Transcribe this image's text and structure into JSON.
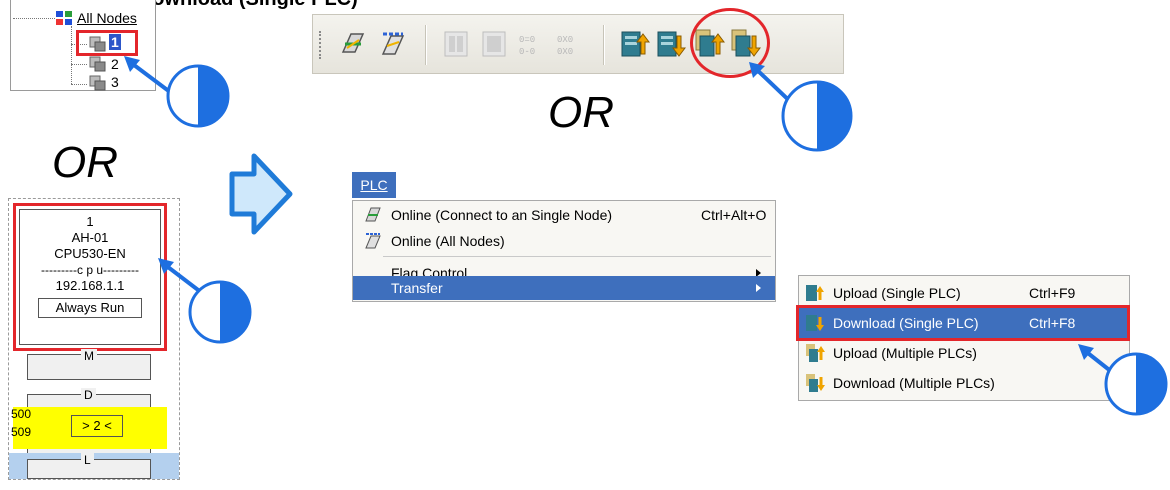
{
  "top_title": "g   Download (Single PLC)",
  "tree": {
    "root_label": "All Nodes",
    "nodes": [
      "1",
      "2",
      "3"
    ]
  },
  "or_label": "OR",
  "device": {
    "slot": "1",
    "model": "AH-01",
    "cpu_model": "CPU530-EN",
    "cpu_divider": "---------c p u---------",
    "ip": "192.168.1.1",
    "status": "Always Run",
    "modules": [
      {
        "label": "M"
      },
      {
        "label": "D"
      },
      {
        "label": "L"
      }
    ],
    "range_start": "500",
    "range_end": "509",
    "node_indicator": "> 2 <"
  },
  "menu": {
    "title": "PLC",
    "items": [
      {
        "label": "Online (Connect to an Single Node)",
        "shortcut": "Ctrl+Alt+O",
        "icon": "online-single-icon"
      },
      {
        "label": "Online (All Nodes)",
        "shortcut": "",
        "icon": "online-all-icon"
      },
      {
        "label": "Flag Control",
        "shortcut": "",
        "icon": ""
      },
      {
        "label": "Transfer",
        "shortcut": "",
        "icon": ""
      }
    ]
  },
  "submenu": {
    "items": [
      {
        "label": "Upload (Single PLC)",
        "shortcut": "Ctrl+F9",
        "icon": "upload-single-icon"
      },
      {
        "label": "Download (Single PLC)",
        "shortcut": "Ctrl+F8",
        "icon": "download-single-icon"
      },
      {
        "label": "Upload (Multiple PLCs)",
        "shortcut": "",
        "icon": "upload-multiple-icon"
      },
      {
        "label": "Download (Multiple PLCs)",
        "shortcut": "",
        "icon": "download-multiple-icon"
      }
    ]
  },
  "colors": {
    "highlight": "#3e6fbd",
    "callout_red": "#e3262b",
    "pointer_blue": "#1e6fe0",
    "arrow_fill": "#cfe8fb",
    "node_yellow": "#ffff00",
    "selected_row": "#b4d0ee"
  }
}
